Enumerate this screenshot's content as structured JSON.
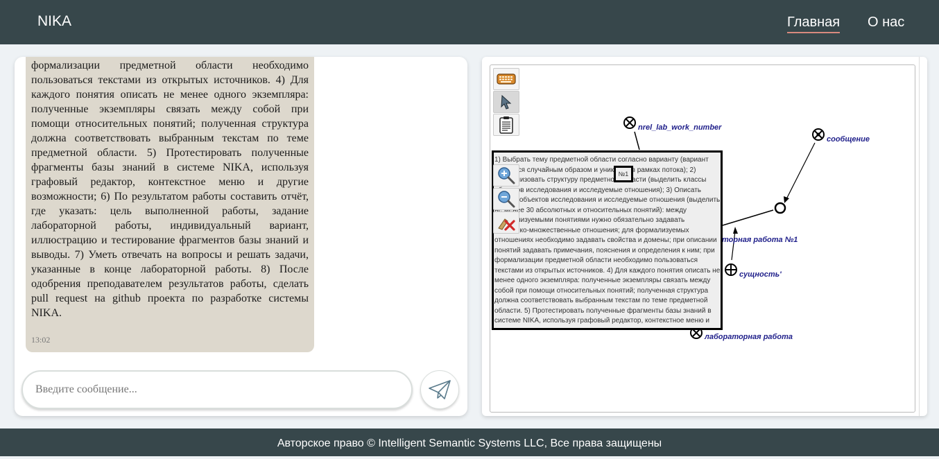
{
  "header": {
    "brand": "NIKA",
    "nav": {
      "home": "Главная",
      "about": "О нас"
    }
  },
  "chat": {
    "message": {
      "text": "примечания, пояснения и определения к ним; при формализации предметной области необходимо пользоваться текстами из открытых источников. 4) Для каждого понятия описать не менее одного экземпляра: полученные экземпляры связать между собой при помощи относительных понятий; полученная структура должна соответствовать выбранным текстам по теме предметной области. 5) Протестировать полученные фрагменты базы знаний в системе NIKA, используя графовый редактор, контекстное меню и другие возможности; 6) По результатом работы составить отчёт, где указать: цель выполненной работы, задание лабораторной работы, индивидуальный вариант, иллюстрацию и тестирование фрагментов базы знаний и выводы. 7) Уметь отвечать на вопросы и решать задачи, указанные в конце лабораторной работы. 8) После одобрения преподавателем результатов работы, сделать pull request на github проекта по разработке системы NIKA.",
      "time": "13:02"
    },
    "input": {
      "placeholder": "Введите сообщение...",
      "value": ""
    },
    "send_icon": "paper-plane-icon"
  },
  "graph": {
    "toolbar": [
      {
        "name": "keyboard-icon",
        "active": false
      },
      {
        "name": "pointer-icon",
        "active": true
      },
      {
        "name": "clipboard-icon",
        "active": false
      }
    ],
    "zoom_tools": [
      {
        "name": "zoom-in-icon"
      },
      {
        "name": "zoom-out-icon"
      },
      {
        "name": "clear-icon"
      }
    ],
    "labels": {
      "nrel": "nrel_lab_work_number",
      "message": "сообщение",
      "lab_work_1": "торная работа №1",
      "essence": "сущность'",
      "lab_work": "лабораторная работа"
    },
    "badge": "№1",
    "content_text": "1) Выбрать тему предметной области согласно варианту (вариант выдается случайным образом и уникален в рамках потока); 2) Формализовать структуру предметной области (выделить классы объектов исследования и исследуемые отношения); 3) Описать классы объектов исследования и исследуемые отношения (выделить не менее 30 абсолютных и относительных понятий): между формализуемыми понятиями нужно обязательно задавать теоретико-множественные отношения; для формализуемых отношениях необходимо задавать свойства и домены; при описании понятий задавать примечания, пояснения и определения к ним; при формализации предметной области необходимо пользоваться текстами из открытых источников. 4) Для каждого понятия описать не менее одного экземпляра: полученные экземпляры связать между собой при помощи относительных понятий; полученная структура должна соответствовать выбранным текстам по теме предметной области. 5) Протестировать полученные фрагменты базы знаний в системе NIKA, используя графовый редактор, контекстное меню и другие возможности;"
  },
  "footer": {
    "copyright": "Авторское право © Intelligent Semantic Systems LLC, Все права защищены"
  }
}
